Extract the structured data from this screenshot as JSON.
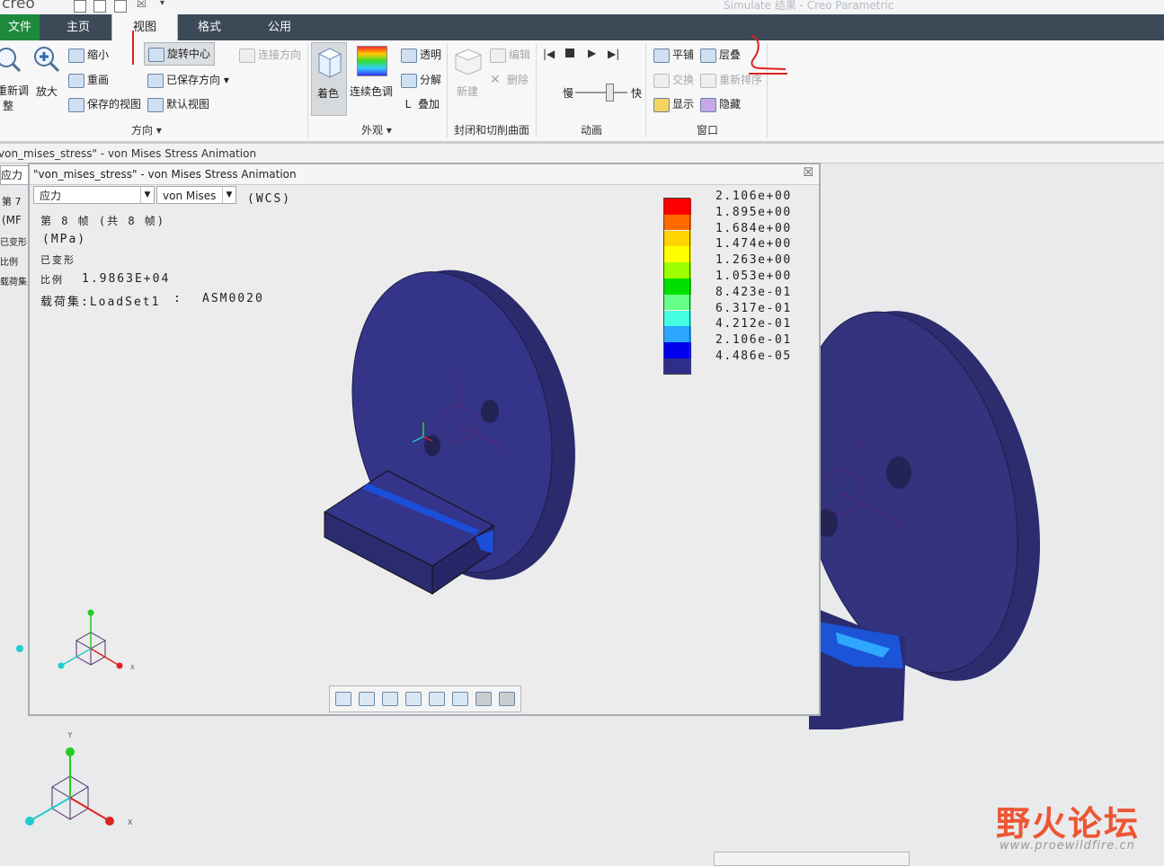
{
  "window": {
    "logo": "creo",
    "title": "Simulate 结果 - Creo Parametric"
  },
  "tabs": [
    "文件",
    "主页",
    "视图",
    "格式",
    "公用"
  ],
  "ribbon": {
    "orientation": {
      "refit_label_1": "重新调",
      "refit_label_2": "整",
      "zoom_in": "放大",
      "zoom_out": "缩小",
      "repaint": "重画",
      "saved_views": "保存的视图",
      "spin_center": "旋转中心",
      "saved_orientation": "已保存方向",
      "default_view": "默认视图",
      "connection_orientation": "连接方向",
      "group_label": "方向"
    },
    "appearance": {
      "shading": "着色",
      "continuous_tone": "连续色调",
      "transparent": "透明",
      "explode": "分解",
      "overlay": "叠加",
      "group_label": "外观"
    },
    "capping": {
      "new": "新建",
      "edit": "编辑",
      "delete": "删除",
      "group_label": "封闭和切削曲面"
    },
    "animation": {
      "slow": "慢",
      "fast": "快",
      "group_label": "动画"
    },
    "window": {
      "tile": "平铺",
      "cascade": "层叠",
      "swap": "交换",
      "reorder": "重新排序",
      "show": "显示",
      "hide": "隐藏",
      "group_label": "窗口"
    }
  },
  "band_text": "von_mises_stress\" - von Mises Stress Animation",
  "left_strip": [
    "应力",
    "第 7",
    "(MF",
    "已变形",
    "比例",
    "载荷集"
  ],
  "dialog": {
    "title": "\"von_mises_stress\" - von Mises Stress Animation",
    "quantity_select": "应力",
    "component_select": "von Mises",
    "wcs": "(WCS)",
    "frame_text": "第 8 帧 (共 8 帧)",
    "units": "(MPa)",
    "deformed": "已变形",
    "scale_label": "比例",
    "scale_value": "1.9863E+04",
    "loadset_label": "载荷集:LoadSet1",
    "loadset_sep": ":",
    "loadset_value": "ASM0020"
  },
  "legend": {
    "colors": [
      "#ff0000",
      "#ff6a00",
      "#ffd400",
      "#ffff00",
      "#9cff00",
      "#00e000",
      "#66ff88",
      "#44ffe0",
      "#2aa6ff",
      "#0000ee",
      "#2e2e8a"
    ],
    "values": [
      "2.106e+00",
      "1.895e+00",
      "1.684e+00",
      "1.474e+00",
      "1.263e+00",
      "1.053e+00",
      "8.423e-01",
      "6.317e-01",
      "4.212e-01",
      "2.106e-01",
      "4.486e-05"
    ]
  },
  "axes": {
    "x": "X",
    "y": "Y"
  },
  "watermark": {
    "name": "野火论坛",
    "url": "www.proewildfire.cn"
  }
}
